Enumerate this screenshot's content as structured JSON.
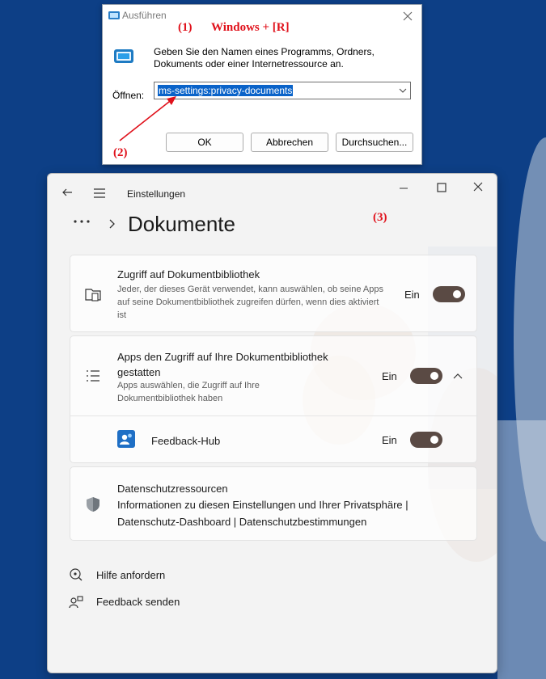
{
  "run_dialog": {
    "title": "Ausführen",
    "description": "Geben Sie den Namen eines Programms, Ordners, Dokuments oder einer Internetressource an.",
    "open_label": "Öffnen:",
    "input_value": "ms-settings:privacy-documents",
    "ok_label": "OK",
    "cancel_label": "Abbrechen",
    "browse_label": "Durchsuchen..."
  },
  "annotations": {
    "step1": "(1)",
    "step1_text": "Windows + [R]",
    "step2": "(2)",
    "step3": "(3)",
    "color": "#e0111b"
  },
  "settings": {
    "app_title": "Einstellungen",
    "page_title": "Dokumente",
    "toggle_color": "#5a4a44",
    "library_access": {
      "title": "Zugriff auf Dokumentbibliothek",
      "subtitle": "Jeder, der dieses Gerät verwendet, kann auswählen, ob seine Apps auf seine Dokumentbibliothek zugreifen dürfen, wenn dies aktiviert ist",
      "state": "Ein"
    },
    "apps_access": {
      "title": "Apps den Zugriff auf Ihre Dokumentbibliothek gestatten",
      "subtitle": "Apps auswählen, die Zugriff auf Ihre Dokumentbibliothek haben",
      "state": "Ein"
    },
    "feedback_hub": {
      "name": "Feedback-Hub",
      "state": "Ein"
    },
    "privacy_resources": {
      "title": "Datenschutzressourcen",
      "text": "Informationen zu diesen Einstellungen und Ihrer Privatsphäre | Datenschutz-Dashboard | Datenschutzbestimmungen"
    },
    "help_link": "Hilfe anfordern",
    "feedback_link": "Feedback senden"
  }
}
